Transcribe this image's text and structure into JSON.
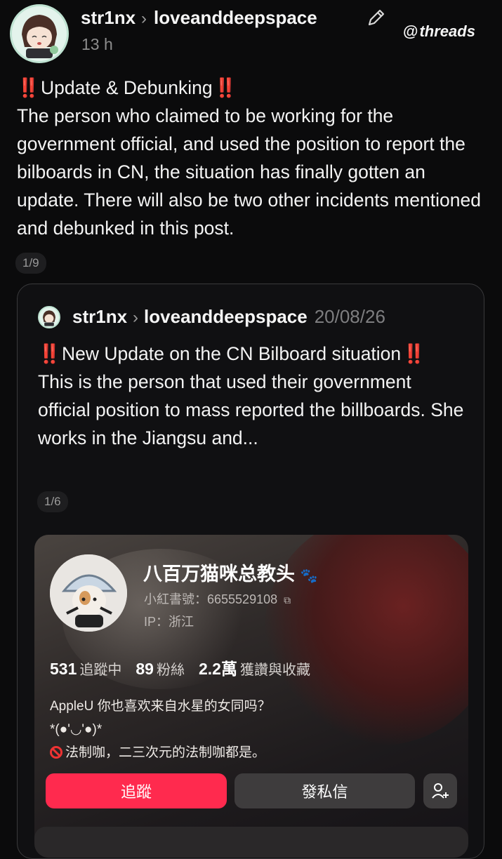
{
  "header": {
    "username": "str1nx",
    "community": "loveanddeepspace",
    "time": "13 h",
    "brand": "threads"
  },
  "post": {
    "bang": "‼️",
    "title": "Update & Debunking",
    "body": "The person who claimed to be working for the government official, and used the position to report the bilboards in CN, the situation has finally gotten an update. There will also be two other incidents mentioned and debunked in this post.",
    "page_indicator": "1/9"
  },
  "quote": {
    "username": "str1nx",
    "community": "loveanddeepspace",
    "date": "20/08/26",
    "title": "New Update on the CN Bilboard situation",
    "body": "This is the person that used their government official position to mass reported the billboards. She works in the Jiangsu and...",
    "page_indicator": "1/6"
  },
  "xhs_profile": {
    "name": "八百万猫咪总教头",
    "id_label": "小紅書號：6655529108",
    "ip_label": "IP：浙江",
    "following_count": "531",
    "following_label": "追蹤中",
    "followers_count": "89",
    "followers_label": "粉絲",
    "likes_count": "2.2萬",
    "likes_label": "獲讚與收藏",
    "bio_line1": "AppleU 你也喜欢来自水星的女同吗？",
    "bio_line2": "*(●'◡'●)*",
    "bio_line3": "法制咖，二三次元的法制咖都是。",
    "follow_button": "追蹤",
    "message_button": "發私信"
  },
  "colors": {
    "background": "#0b0b0c",
    "alert_red": "#e01a1a",
    "follow_pink": "#ff2a4e"
  }
}
